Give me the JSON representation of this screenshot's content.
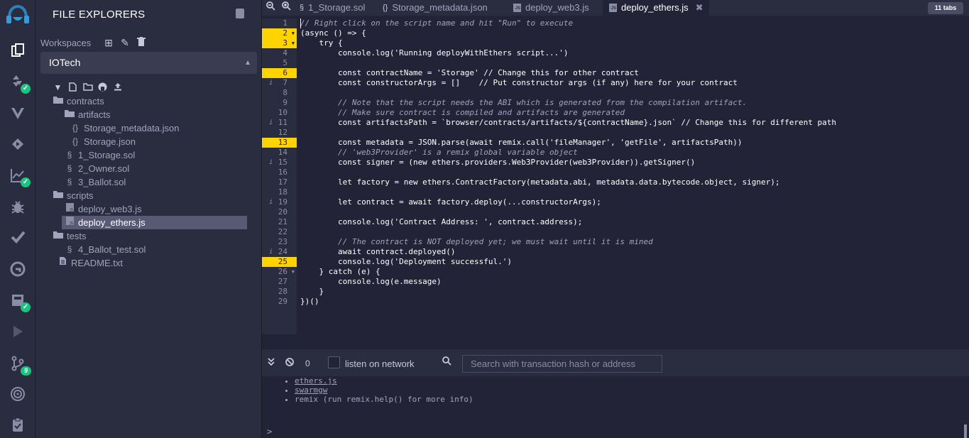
{
  "sidebar": {
    "title": "FILE EXPLORERS",
    "workspaces_label": "Workspaces",
    "workspace_selected": "IOTech",
    "icons": [
      "file-explorers-icon",
      "solidity-compiler-icon",
      "vyper-icon",
      "deploy-run-icon",
      "analysis-icon",
      "debugger-icon",
      "unit-testing-icon",
      "plugin-icon",
      "compile-icon",
      "run-script-icon",
      "git-icon",
      "tornado-icon",
      "settings-icon"
    ],
    "git_badge": "9",
    "tree": [
      {
        "label": "contracts",
        "type": "folder"
      },
      {
        "label": "artifacts",
        "type": "folder"
      },
      {
        "label": "Storage_metadata.json",
        "type": "json"
      },
      {
        "label": "Storage.json",
        "type": "json"
      },
      {
        "label": "1_Storage.sol",
        "type": "sol"
      },
      {
        "label": "2_Owner.sol",
        "type": "sol"
      },
      {
        "label": "3_Ballot.sol",
        "type": "sol"
      },
      {
        "label": "scripts",
        "type": "folder"
      },
      {
        "label": "deploy_web3.js",
        "type": "js"
      },
      {
        "label": "deploy_ethers.js",
        "type": "js"
      },
      {
        "label": "tests",
        "type": "folder"
      },
      {
        "label": "4_Ballot_test.sol",
        "type": "sol"
      },
      {
        "label": "README.txt",
        "type": "txt"
      }
    ]
  },
  "tabs": {
    "items": [
      {
        "label": "1_Storage.sol"
      },
      {
        "label": "Storage_metadata.json"
      },
      {
        "label": "deploy_web3.js"
      },
      {
        "label": "deploy_ethers.js",
        "active": true
      }
    ],
    "count_label": "11 tabs"
  },
  "editor": {
    "highlighted_lines": [
      2,
      3,
      6,
      13,
      25
    ],
    "info_lines": [
      7,
      11,
      15,
      19,
      24
    ],
    "fold_lines": [
      2,
      3,
      26
    ],
    "lines": [
      "// Right click on the script name and hit \"Run\" to execute",
      "(async () => {",
      "    try {",
      "        console.log('Running deployWithEthers script...')",
      "",
      "        const contractName = 'Storage' // Change this for other contract",
      "        const constructorArgs = []    // Put constructor args (if any) here for your contract",
      "",
      "        // Note that the script needs the ABI which is generated from the compilation artifact.",
      "        // Make sure contract is compiled and artifacts are generated",
      "        const artifactsPath = `browser/contracts/artifacts/${contractName}.json` // Change this for different path",
      "",
      "        const metadata = JSON.parse(await remix.call('fileManager', 'getFile', artifactsPath))",
      "        // 'web3Provider' is a remix global variable object",
      "        const signer = (new ethers.providers.Web3Provider(web3Provider)).getSigner()",
      "",
      "        let factory = new ethers.ContractFactory(metadata.abi, metadata.data.bytecode.object, signer);",
      "",
      "        let contract = await factory.deploy(...constructorArgs);",
      "",
      "        console.log('Contract Address: ', contract.address);",
      "",
      "        // The contract is NOT deployed yet; we must wait until it is mined",
      "        await contract.deployed()",
      "        console.log('Deployment successful.')",
      "    } catch (e) {",
      "        console.log(e.message)",
      "    }",
      "})()"
    ]
  },
  "terminal": {
    "pending_count": "0",
    "listen_label": "listen on network",
    "search_placeholder": "Search with transaction hash or address",
    "items": [
      {
        "text": "ethers.js",
        "link": true
      },
      {
        "text": "swarmgw",
        "link": true
      },
      {
        "text": "remix (run remix.help() for more info)",
        "link": false
      }
    ],
    "prompt": ">"
  },
  "colors": {
    "highlight": "#ffd300",
    "success": "#1ac47f",
    "panel": "#2a2c3f",
    "editor_bg": "#222336"
  }
}
